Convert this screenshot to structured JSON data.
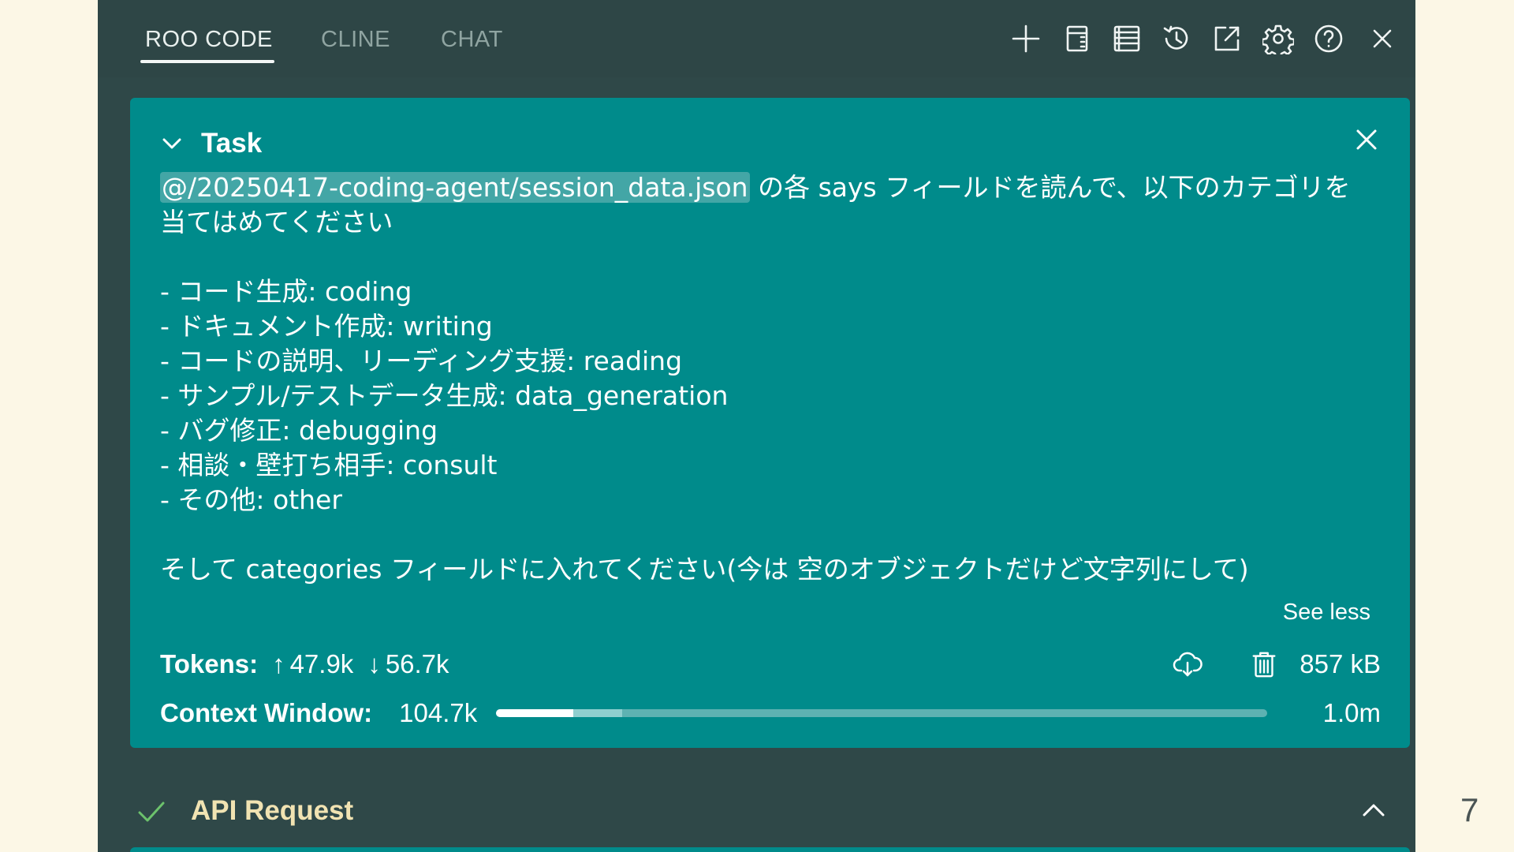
{
  "tabs": [
    {
      "label": "ROO CODE",
      "active": true
    },
    {
      "label": "CLINE",
      "active": false
    },
    {
      "label": "CHAT",
      "active": false
    }
  ],
  "toolbar_icons": [
    "plus-icon",
    "mcp-server-icon",
    "prompts-icon",
    "history-icon",
    "popout-icon",
    "gear-icon",
    "help-icon",
    "close-icon"
  ],
  "task": {
    "title": "Task",
    "mention": "@/20250417-coding-agent/session_data.json",
    "line1_rest": " の各 says フィールドを読んで、以下のカテゴリを",
    "line2": "当てはめてください",
    "categories": [
      "- コード生成: coding",
      "- ドキュメント作成: writing",
      "- コードの説明、リーディング支援: reading",
      "- サンプル/テストデータ生成: data_generation",
      "- バグ修正: debugging",
      "- 相談・壁打ち相手: consult",
      "- その他: other"
    ],
    "closing": "そして categories フィールドに入れてください(今は 空のオブジェクトだけど文字列にして)",
    "see_less": "See less",
    "tokens_label": "Tokens:",
    "tokens_up": "47.9k",
    "tokens_down": "56.7k",
    "size": "857 kB",
    "context_label": "Context Window:",
    "context_value": "104.7k",
    "context_max": "1.0m",
    "context_used_fraction": 0.1,
    "context_reserved_fraction": 0.063
  },
  "api_request": {
    "title": "API Request",
    "status": "success"
  },
  "page_number": "7",
  "colors": {
    "panel_bg": "#2f4848",
    "task_bg": "#008b8b",
    "api_title": "#f1e3b2",
    "check": "#6cc26c",
    "page_bg": "#fcf7e6"
  }
}
